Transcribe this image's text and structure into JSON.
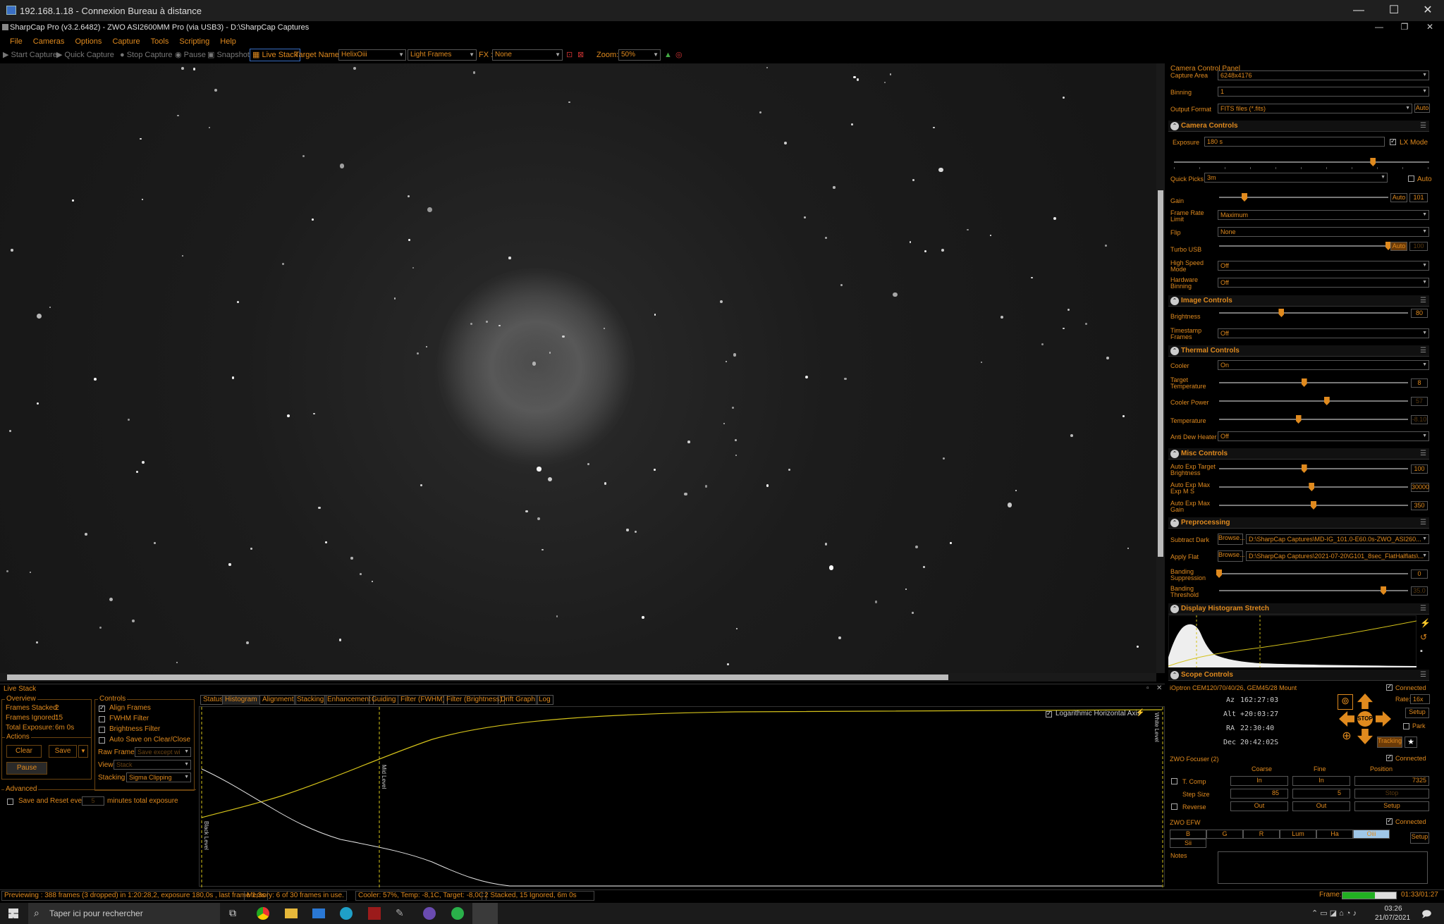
{
  "rdp": {
    "title": "192.168.1.18 - Connexion Bureau à distance"
  },
  "app": {
    "title": "SharpCap Pro (v3.2.6482) - ZWO ASI2600MM Pro (via USB3) - D:\\SharpCap Captures"
  },
  "menu": [
    "File",
    "Cameras",
    "Options",
    "Capture",
    "Tools",
    "Scripting",
    "Help"
  ],
  "toolbar": {
    "start_capture": "Start Capture",
    "quick_capture": "Quick Capture",
    "stop_capture": "Stop Capture",
    "pause": "Pause",
    "snapshot": "Snapshot",
    "live_stack": "Live Stack",
    "target_label": "Target Name :",
    "target_value": "HelixOiii",
    "frame_type": "Light Frames",
    "fx_label": "FX :",
    "fx_value": "None",
    "zoom_label": "Zoom:",
    "zoom_value": "50%"
  },
  "live_stack": {
    "header": "Live Stack",
    "overview": {
      "title": "Overview",
      "frames_stacked_label": "Frames Stacked:",
      "frames_stacked": "2",
      "frames_ignored_label": "Frames Ignored:",
      "frames_ignored": "15",
      "total_exposure_label": "Total Exposure:",
      "total_exposure": "6m 0s"
    },
    "actions": {
      "title": "Actions",
      "clear": "Clear",
      "save": "Save",
      "pause": "Pause"
    },
    "controls": {
      "title": "Controls",
      "align": "Align Frames",
      "fwhm": "FWHM Filter",
      "brightness": "Brightness Filter",
      "autosave": "Auto Save on Clear/Close",
      "raw_label": "Raw Frames",
      "raw_value": "Save except wi",
      "view_label": "View",
      "view_value": "Stack",
      "stacking_label": "Stacking",
      "stacking_value": "Sigma Clipping"
    },
    "advanced": {
      "title": "Advanced",
      "save_reset": "Save and Reset every",
      "minutes_value": "5",
      "minutes_suffix": "minutes total exposure"
    },
    "tabs": [
      "Status",
      "Histogram",
      "Alignment",
      "Stacking",
      "Enhancement",
      "Guiding",
      "Filter (FWHM)",
      "Filter (Brightness)",
      "Drift Graph",
      "Log"
    ],
    "selected_tab": "Histogram",
    "histogram": {
      "log_axis": "Logarithmic Horizontal Axis",
      "black_level": "Black Level",
      "mid_level": "Mid Level",
      "white_level": "White Level"
    }
  },
  "status_bar": {
    "previewing": "Previewing : 388 frames (3 dropped) in 1:20:28,2, exposure 180,0s , last frame 1,3s",
    "memory": "Memory: 6 of 30 frames in use.",
    "cooler": "Cooler: 57%, Temp: -8,1C, Target: -8,0C",
    "stacked": "2 Stacked, 15 Ignored, 6m 0s",
    "frame_label": "Frame:",
    "frame_progress": 0.6,
    "elapsed": "01:33/01:27"
  },
  "panel": {
    "title": "Camera Control Panel",
    "capture_area_label": "Capture Area",
    "capture_area": "6248x4176",
    "binning_label": "Binning",
    "binning": "1",
    "output_format_label": "Output Format",
    "output_format": "FITS files (*.fits)",
    "auto": "Auto",
    "camera_controls": "Camera Controls",
    "exposure_label": "Exposure",
    "exposure": "180 s",
    "lx_mode": "LX Mode",
    "exposure_level": 0.78,
    "quick_picks_label": "Quick Picks",
    "quick_picks": "3m",
    "gain_label": "Gain",
    "gain_auto": "Auto",
    "gain": "101",
    "gain_level": 0.15,
    "frame_rate_label": "Frame Rate Limit",
    "frame_rate": "Maximum",
    "flip_label": "Flip",
    "flip": "None",
    "turbo_label": "Turbo USB",
    "turbo_auto": "Auto",
    "turbo": "100",
    "turbo_level": 1.0,
    "high_speed_label": "High Speed Mode",
    "high_speed": "Off",
    "hw_binning_label": "Hardware Binning",
    "hw_binning": "Off",
    "image_controls": "Image Controls",
    "brightness_label": "Brightness",
    "brightness": "80",
    "brightness_level": 0.33,
    "timestamp_label": "Timestamp Frames",
    "timestamp": "Off",
    "thermal_controls": "Thermal Controls",
    "cooler_label": "Cooler",
    "cooler": "On",
    "target_temp_label": "Target Temperature",
    "target_temp": "8",
    "target_temp_level": 0.45,
    "cooler_power_label": "Cooler Power",
    "cooler_power": "57",
    "cooler_power_level": 0.57,
    "temperature_label": "Temperature",
    "temperature": "-8.10",
    "temperature_level": 0.42,
    "anti_dew_label": "Anti Dew Heater",
    "anti_dew": "Off",
    "misc_controls": "Misc Controls",
    "auto_exp_target_label": "Auto Exp Target Brightness",
    "auto_exp_target": "100",
    "auto_exp_target_level": 0.45,
    "auto_exp_max_label": "Auto Exp Max Exp M S",
    "auto_exp_max": "30000",
    "auto_exp_max_level": 0.49,
    "auto_exp_gain_label": "Auto Exp Max Gain",
    "auto_exp_gain": "350",
    "auto_exp_gain_level": 0.5,
    "preprocessing": "Preprocessing",
    "subtract_dark_label": "Subtract Dark",
    "browse": "Browse...",
    "subtract_dark": "D:\\SharpCap Captures\\MD-IG_101.0-E60.0s-ZWO_ASI260...",
    "apply_flat_label": "Apply Flat",
    "apply_flat": "D:\\SharpCap Captures\\2021-07-20\\G101_8sec_FlatHalflats\\...",
    "banding_supp_label": "Banding Suppression",
    "banding_supp": "0",
    "banding_supp_level": 0.0,
    "banding_thresh_label": "Banding Threshold",
    "banding_thresh": "35.0",
    "banding_thresh_level": 0.87,
    "display_stretch": "Display Histogram Stretch",
    "scope_controls": "Scope Controls",
    "mount": "iOptron CEM120/70/40/26, GEM45/28 Mount",
    "connected": "Connected",
    "rate_label": "Rate:",
    "rate": "16x",
    "az_label": "Az",
    "az": "162:27:03",
    "alt_label": "Alt",
    "alt": "+20:03:27",
    "ra_label": "RA",
    "ra": "22:30:40",
    "dec_label": "Dec",
    "dec": "20:42:02S",
    "stop": "STOP",
    "setup": "Setup",
    "park": "Park",
    "tracking": "Tracking",
    "focuser": "ZWO Focuser (2)",
    "coarse": "Coarse",
    "fine": "Fine",
    "position": "Position",
    "t_comp": "T. Comp",
    "in": "In",
    "out": "Out",
    "position_value": "7325",
    "step_size_label": "Step Size",
    "coarse_step": "85",
    "fine_step": "5",
    "stop_btn": "Stop",
    "reverse": "Reverse",
    "efw": "ZWO EFW",
    "filters": [
      "B",
      "G",
      "R",
      "Lum",
      "Ha",
      "Oiii",
      "Sii"
    ],
    "selected_filter": "Oiii",
    "notes_label": "Notes"
  },
  "taskbar": {
    "search": "Taper ici pour rechercher",
    "time": "03:26",
    "date": "21/07/2021"
  },
  "colors": {
    "accent": "#e08a1e",
    "histogram_curve": "#d4c21a",
    "background": "#000000"
  }
}
